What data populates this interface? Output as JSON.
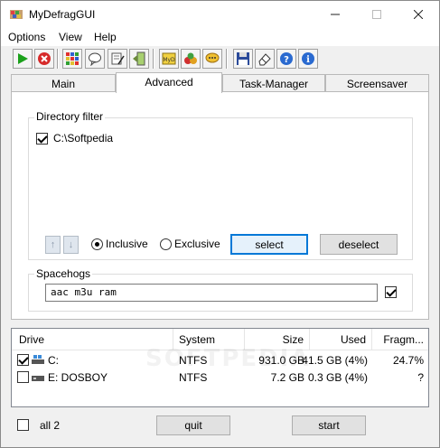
{
  "window": {
    "title": "MyDefragGUI"
  },
  "menu": [
    {
      "id": "options",
      "label": "Options"
    },
    {
      "id": "view",
      "label": "View"
    },
    {
      "id": "help",
      "label": "Help"
    }
  ],
  "toolbar": {
    "icons": [
      "play-icon",
      "stop-icon",
      "grid-icon",
      "speech-bubble-icon",
      "notepad-icon",
      "exit-door-icon",
      "myd-icon",
      "apples-icon",
      "chat-icon",
      "save-icon",
      "eraser-icon",
      "help-icon",
      "info-icon"
    ]
  },
  "tabs": [
    {
      "id": "main",
      "label": "Main",
      "active": false
    },
    {
      "id": "advanced",
      "label": "Advanced",
      "active": true
    },
    {
      "id": "task-manager",
      "label": "Task-Manager",
      "active": false
    },
    {
      "id": "screensaver",
      "label": "Screensaver",
      "active": false
    }
  ],
  "directory_filter": {
    "label": "Directory filter",
    "items": [
      {
        "path": "C:\\Softpedia",
        "checked": true
      }
    ],
    "mode_inclusive": "Inclusive",
    "mode_exclusive": "Exclusive",
    "selected_mode": "Inclusive",
    "select_label": "select",
    "deselect_label": "deselect"
  },
  "spacehogs": {
    "label": "Spacehogs",
    "value": "aac m3u ram",
    "checked": true
  },
  "drives": {
    "columns": [
      "Drive",
      "System",
      "Size",
      "Used",
      "Fragm..."
    ],
    "rows": [
      {
        "name": "C:",
        "system": "NTFS",
        "size": "931.0 GB",
        "used": "41.5 GB (4%)",
        "frag": "24.7%",
        "checked": true
      },
      {
        "name": "E: DOSBOY",
        "system": "NTFS",
        "size": "7.2 GB",
        "used": "0.3 GB (4%)",
        "frag": "?",
        "checked": false
      }
    ]
  },
  "watermark": "SOFTPEDIA",
  "footer": {
    "all_label": "all 2",
    "all_checked": false,
    "quit_label": "quit",
    "start_label": "start"
  }
}
